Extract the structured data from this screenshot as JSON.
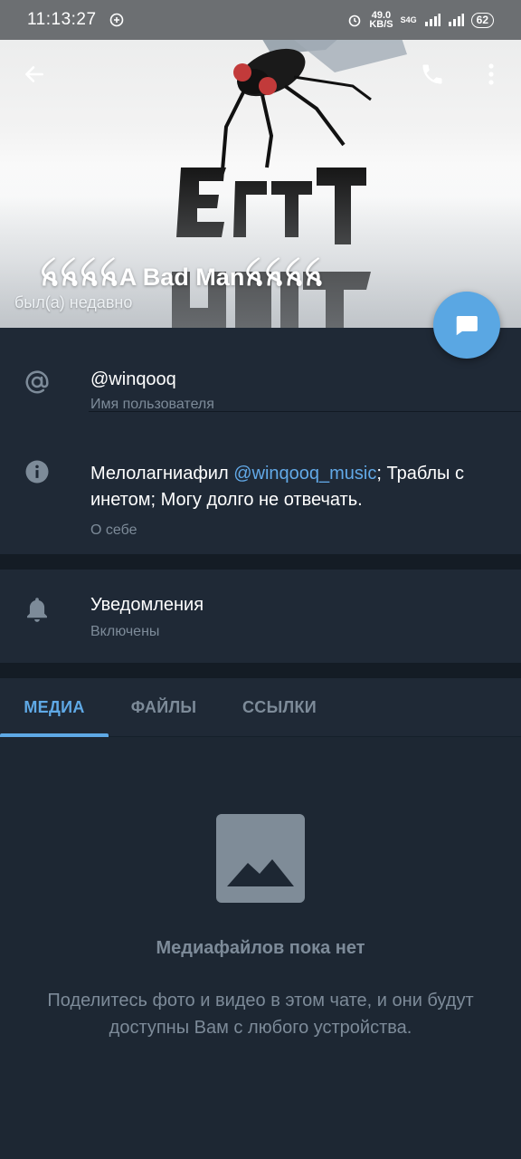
{
  "status_bar": {
    "time": "11:13:27",
    "speed_value": "49.0",
    "speed_unit": "KB/S",
    "network_label": "S4G",
    "battery": "62"
  },
  "profile": {
    "name": "ꫝꫝꫝꫝA Bad Manꫝꫝꫝꫝ",
    "last_seen": "был(а) недавно"
  },
  "info": {
    "username": "@winqooq",
    "username_label": "Имя пользователя",
    "bio_prefix": "Мелолагниафил ",
    "bio_link": "@winqooq_music",
    "bio_suffix": "; Траблы с инетом; Могу долго не отвечать.",
    "bio_label": "О себе",
    "notifications_title": "Уведомления",
    "notifications_value": "Включены"
  },
  "tabs": [
    {
      "label": "МЕДИА",
      "active": true
    },
    {
      "label": "ФАЙЛЫ",
      "active": false
    },
    {
      "label": "ССЫЛКИ",
      "active": false
    }
  ],
  "empty_state": {
    "title": "Медиафайлов пока нет",
    "description": "Поделитесь фото и видео в этом чате, и они будут доступны Вам с любого устройства."
  },
  "icons": {
    "back": "back-arrow-icon",
    "call": "phone-icon",
    "more": "more-vertical-icon",
    "message": "message-icon",
    "username": "at-sign-icon",
    "about": "info-icon",
    "notifications": "bell-icon",
    "media_placeholder": "image-icon"
  },
  "colors": {
    "accent": "#5fa9e6",
    "background": "#1d2733",
    "card": "#1f2936",
    "secondary_text": "#7d8b99"
  }
}
